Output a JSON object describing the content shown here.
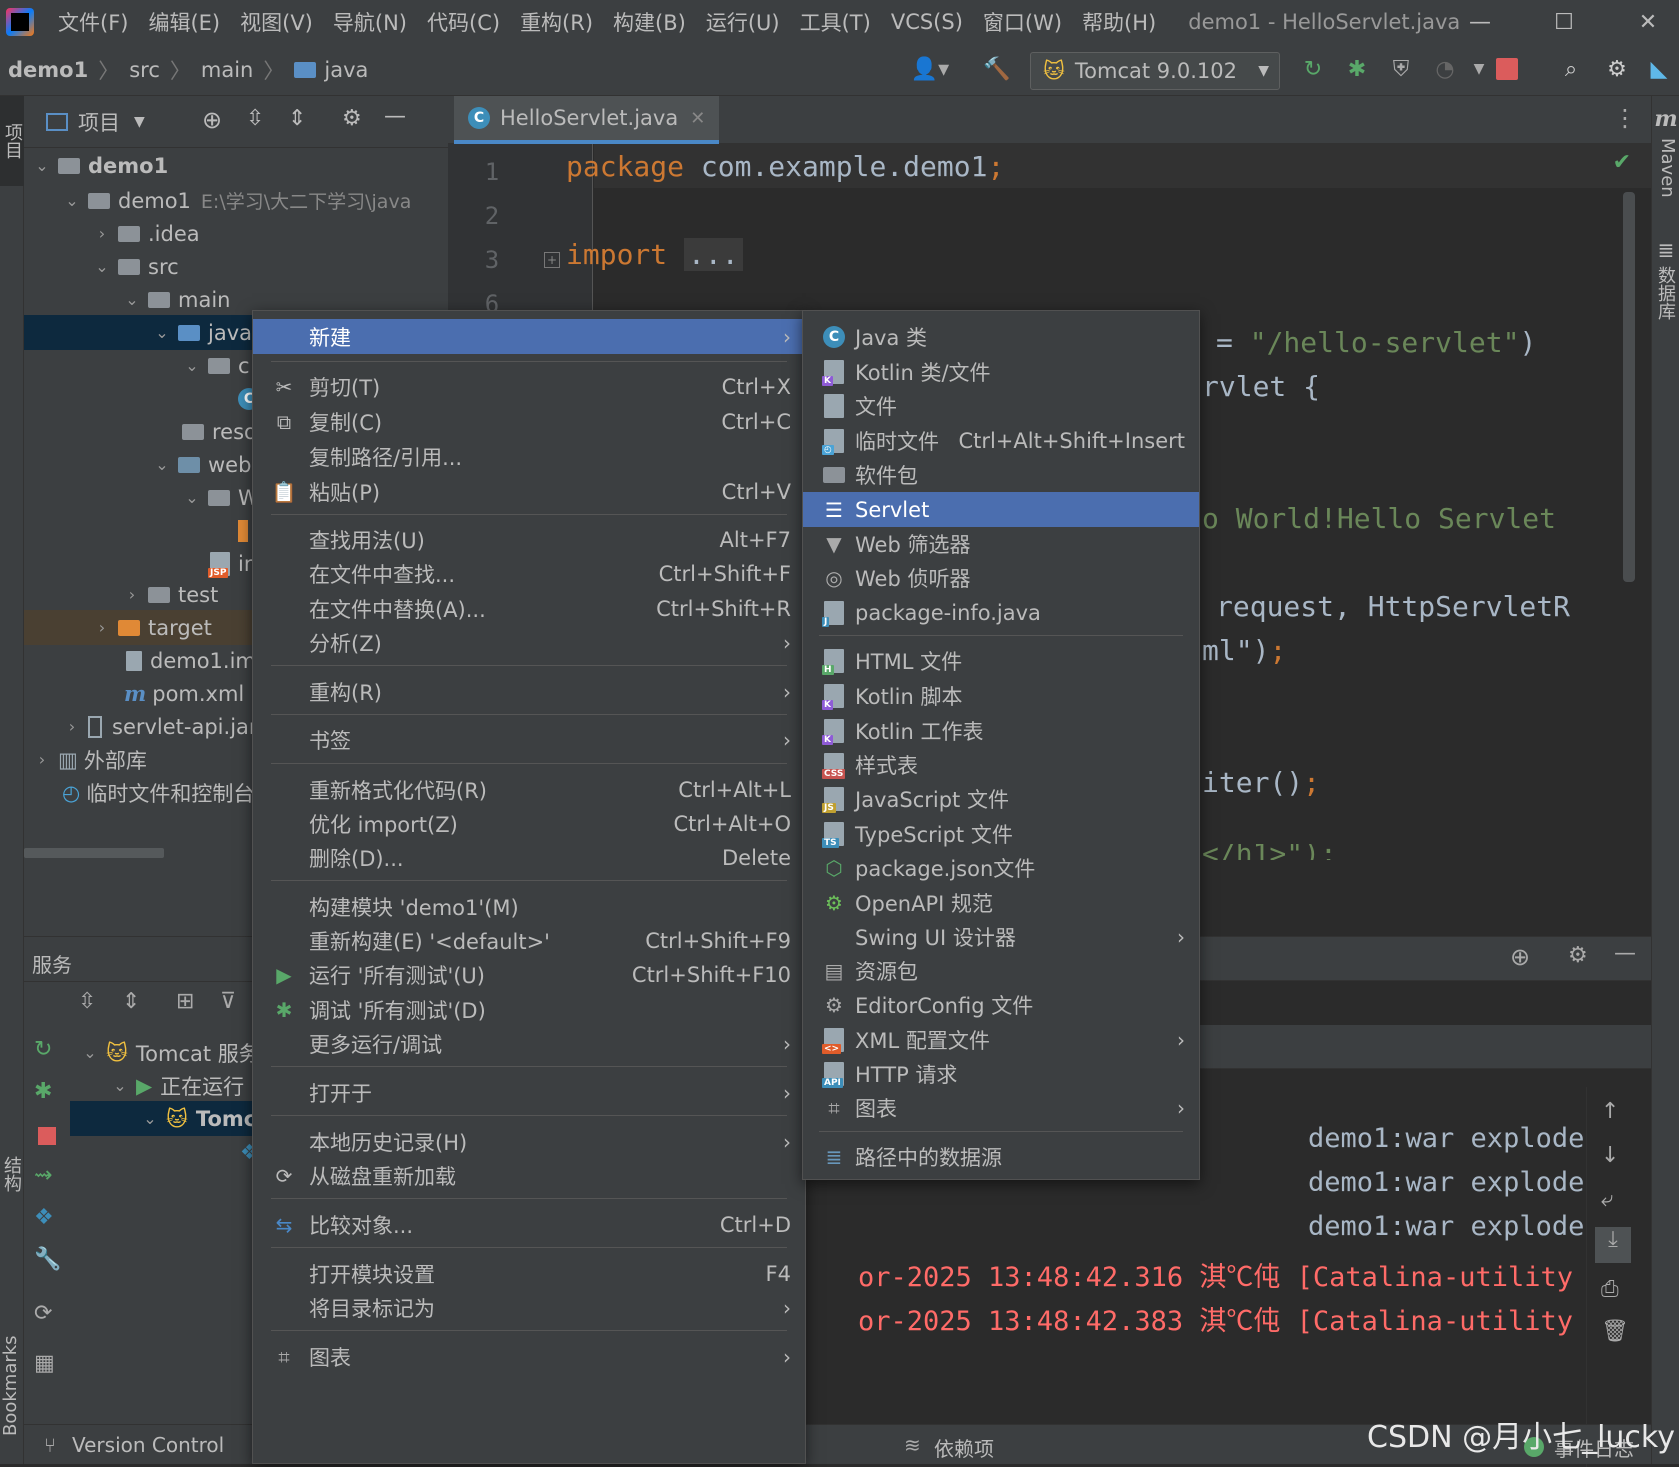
{
  "menubar": {
    "items": [
      "文件(F)",
      "编辑(E)",
      "视图(V)",
      "导航(N)",
      "代码(C)",
      "重构(R)",
      "构建(B)",
      "运行(U)",
      "工具(T)",
      "VCS(S)",
      "窗口(W)",
      "帮助(H)"
    ],
    "window_title": "demo1 - HelloServlet.java"
  },
  "navbar": {
    "breadcrumb": [
      "demo1",
      "src",
      "main",
      "java"
    ],
    "run_config": "Tomcat 9.0.102"
  },
  "project_panel": {
    "title": "项目",
    "tree": [
      {
        "label": "demo1",
        "bold": true
      },
      {
        "label": "demo1",
        "path": "E:\\学习\\大二下学习\\java"
      },
      {
        "label": ".idea"
      },
      {
        "label": "src"
      },
      {
        "label": "main"
      },
      {
        "label": "java"
      },
      {
        "label": "c"
      },
      {
        "label": ""
      },
      {
        "label": "reso"
      },
      {
        "label": "web"
      },
      {
        "label": "W"
      },
      {
        "label": ""
      },
      {
        "label": "in"
      },
      {
        "label": "test"
      },
      {
        "label": "target"
      },
      {
        "label": "demo1.iml"
      },
      {
        "label": "pom.xml"
      },
      {
        "label": "servlet-api.jar"
      },
      {
        "label": "外部库"
      },
      {
        "label": "临时文件和控制台"
      }
    ]
  },
  "services": {
    "title": "服务",
    "tree": [
      "Tomcat 服务",
      "正在运行",
      "Tomc"
    ]
  },
  "editor": {
    "tab": "HelloServlet.java",
    "line_numbers": [
      "1",
      "2",
      "3",
      "6"
    ],
    "code": {
      "l1_kw": "package",
      "l1_rest": " com.example.demo1",
      "l1_semi": ";",
      "l3_kw": "import",
      "l3_fold": "...",
      "c_servlet_eq": "= ",
      "c_servlet_str": "\"/hello-servlet\"",
      "c_servlet_close": ")",
      "c_class": "rvlet {",
      "c_hello": "o World!Hello Servlet",
      "c_request": "request, HttpServletR",
      "c_ml": "ml\")",
      "c_ml_semi": ";",
      "c_iter": "iter()",
      "c_iter_semi": ";",
      "c_h1": "</h1>\");"
    }
  },
  "console": {
    "lines": [
      "demo1:war explode",
      "demo1:war explode",
      "demo1:war explode"
    ],
    "log": [
      {
        "time": "or-2025 13:48:42.316",
        "garbled": "淇℃伅",
        "thread": "[Catalina-utility"
      },
      {
        "time": "or-2025 13:48:42.383",
        "garbled": "淇℃伅",
        "thread": "[Catalina-utility"
      }
    ]
  },
  "right_strip": {
    "maven": "Maven",
    "database": "数据库"
  },
  "left_strip": {
    "project": "项目",
    "structure": "结构",
    "bookmarks": "Bookmarks"
  },
  "statusbar": {
    "version_control": "Version Control",
    "deps": "依赖项",
    "events": "事件日志"
  },
  "context_menu": {
    "items": [
      {
        "label": "新建",
        "submenu": true,
        "highlight": true
      },
      {
        "label": "剪切(T)",
        "shortcut": "Ctrl+X",
        "icon": "cut"
      },
      {
        "label": "复制(C)",
        "shortcut": "Ctrl+C",
        "icon": "copy"
      },
      {
        "label": "复制路径/引用...",
        "shortcut": ""
      },
      {
        "label": "粘贴(P)",
        "shortcut": "Ctrl+V",
        "icon": "paste"
      },
      {
        "label": "查找用法(U)",
        "shortcut": "Alt+F7"
      },
      {
        "label": "在文件中查找...",
        "shortcut": "Ctrl+Shift+F"
      },
      {
        "label": "在文件中替换(A)...",
        "shortcut": "Ctrl+Shift+R"
      },
      {
        "label": "分析(Z)",
        "submenu": true
      },
      {
        "label": "重构(R)",
        "submenu": true
      },
      {
        "label": "书签",
        "submenu": true
      },
      {
        "label": "重新格式化代码(R)",
        "shortcut": "Ctrl+Alt+L"
      },
      {
        "label": "优化 import(Z)",
        "shortcut": "Ctrl+Alt+O"
      },
      {
        "label": "删除(D)...",
        "shortcut": "Delete"
      },
      {
        "label": "构建模块 'demo1'(M)",
        "shortcut": ""
      },
      {
        "label": "重新构建(E) '<default>'",
        "shortcut": "Ctrl+Shift+F9"
      },
      {
        "label": "运行 '所有测试'(U)",
        "shortcut": "Ctrl+Shift+F10",
        "icon": "run"
      },
      {
        "label": "调试 '所有测试'(D)",
        "shortcut": "",
        "icon": "debug"
      },
      {
        "label": "更多运行/调试",
        "submenu": true
      },
      {
        "label": "打开于",
        "submenu": true
      },
      {
        "label": "本地历史记录(H)",
        "submenu": true
      },
      {
        "label": "从磁盘重新加载",
        "shortcut": "",
        "icon": "reload"
      },
      {
        "label": "比较对象...",
        "shortcut": "Ctrl+D",
        "icon": "compare"
      },
      {
        "label": "打开模块设置",
        "shortcut": "F4"
      },
      {
        "label": "将目录标记为",
        "submenu": true
      },
      {
        "label": "图表",
        "submenu": true,
        "icon": "diagram"
      }
    ]
  },
  "submenu_new": {
    "items": [
      {
        "label": "Java 类",
        "icon": "java-class"
      },
      {
        "label": "Kotlin 类/文件",
        "icon": "kotlin"
      },
      {
        "label": "文件",
        "icon": "file"
      },
      {
        "label": "临时文件",
        "shortcut": "Ctrl+Alt+Shift+Insert",
        "icon": "scratch"
      },
      {
        "label": "软件包",
        "icon": "package"
      },
      {
        "label": "Servlet",
        "icon": "servlet",
        "highlight": true
      },
      {
        "label": "Web 筛选器",
        "icon": "filter"
      },
      {
        "label": "Web 侦听器",
        "icon": "listener"
      },
      {
        "label": "package-info.java",
        "icon": "file"
      },
      {
        "label": "HTML 文件",
        "icon": "html"
      },
      {
        "label": "Kotlin 脚本",
        "icon": "kotlin"
      },
      {
        "label": "Kotlin 工作表",
        "icon": "kotlin"
      },
      {
        "label": "样式表",
        "icon": "css"
      },
      {
        "label": "JavaScript 文件",
        "icon": "js"
      },
      {
        "label": "TypeScript 文件",
        "icon": "ts"
      },
      {
        "label": "package.json文件",
        "icon": "npm"
      },
      {
        "label": "OpenAPI 规范",
        "icon": "openapi"
      },
      {
        "label": "Swing UI 设计器",
        "submenu": true
      },
      {
        "label": "资源包",
        "icon": "bundle"
      },
      {
        "label": "EditorConfig 文件",
        "icon": "gear"
      },
      {
        "label": "XML 配置文件",
        "submenu": true,
        "icon": "xml"
      },
      {
        "label": "HTTP 请求",
        "icon": "api"
      },
      {
        "label": "图表",
        "submenu": true,
        "icon": "diagram"
      },
      {
        "label": "路径中的数据源",
        "icon": "database"
      }
    ]
  },
  "watermark": "CSDN @月小七_lucky",
  "colors": {
    "accent": "#4b6eaf",
    "keyword": "#cc7832",
    "string": "#6a8759",
    "error": "#ff6b68"
  }
}
